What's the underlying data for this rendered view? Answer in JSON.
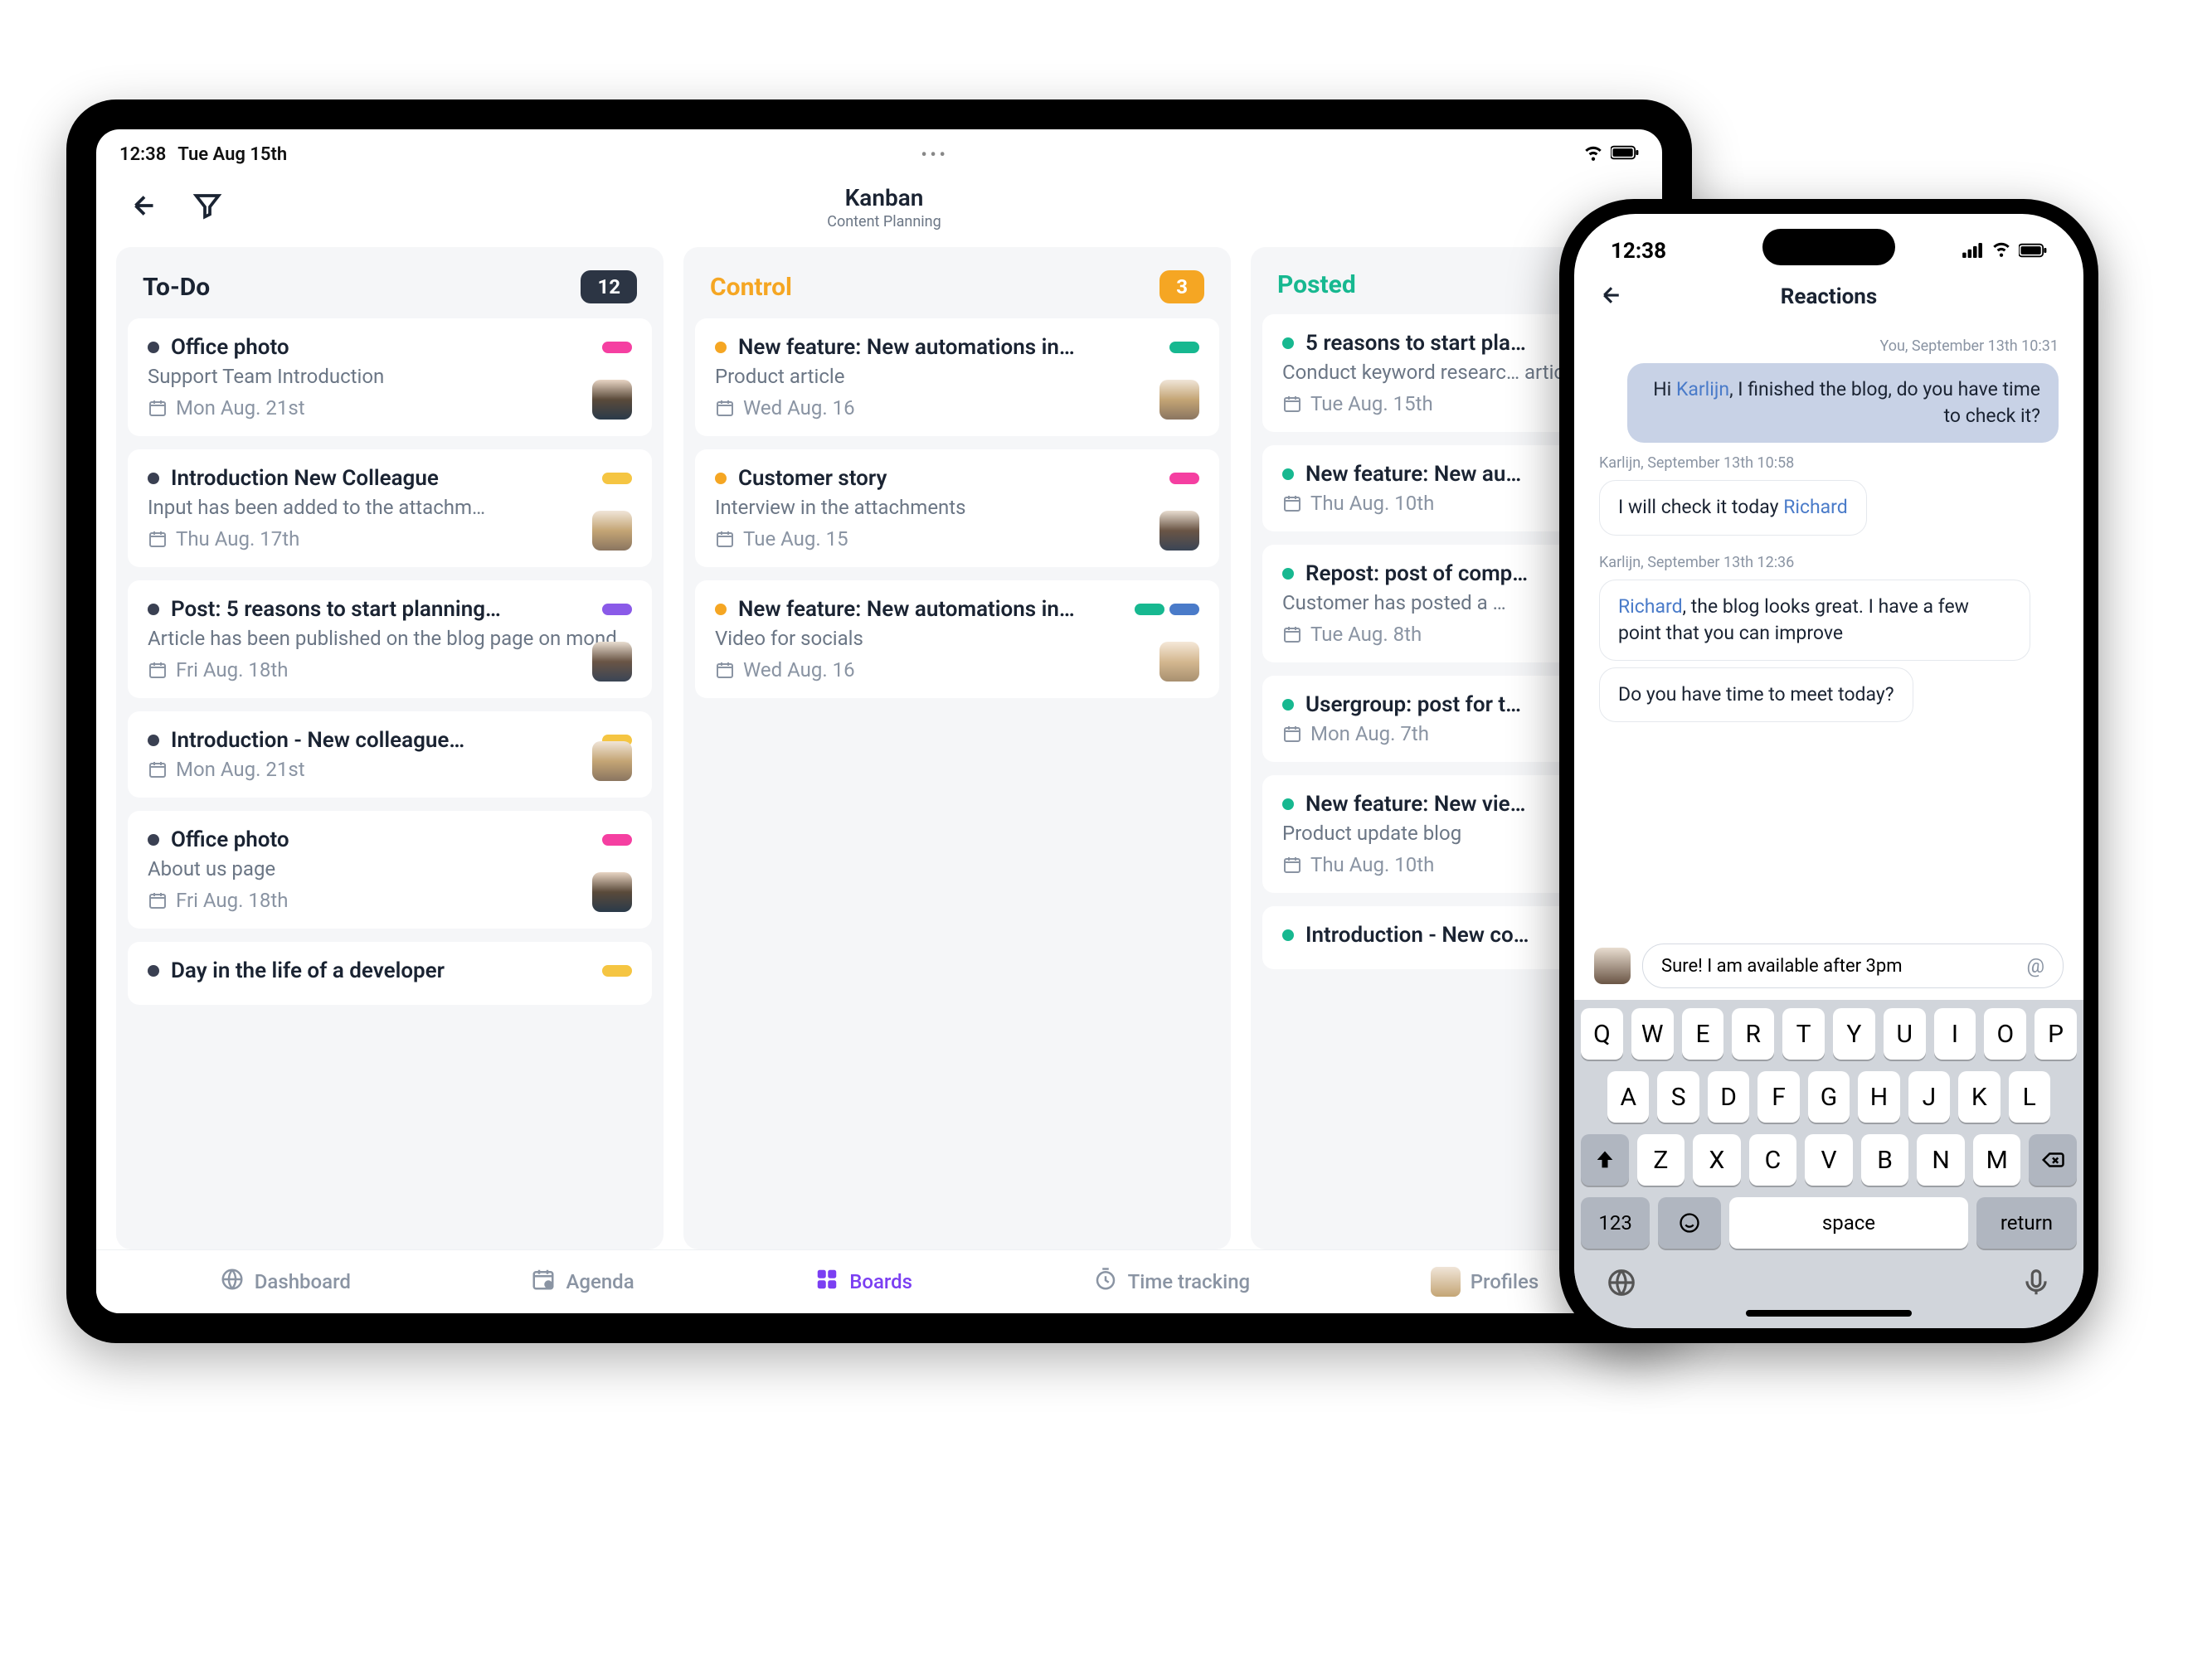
{
  "ipad": {
    "status": {
      "time": "12:38",
      "date": "Tue Aug 15th"
    },
    "header": {
      "title": "Kanban",
      "subtitle": "Content Planning"
    },
    "columns": [
      {
        "id": "todo",
        "title": "To-Do",
        "count": "12",
        "badgeClass": "badge-dark",
        "cards": [
          {
            "dot": "#3a4052",
            "title": "Office photo",
            "desc": "Support Team Introduction",
            "date": "Mon Aug. 21st",
            "pills": [
              "#f53fa1"
            ],
            "avatar": "a1"
          },
          {
            "dot": "#3a4052",
            "title": "Introduction New Colleague",
            "desc": "Input has been added to the attachm…",
            "date": "Thu Aug. 17th",
            "pills": [
              "#f5c542"
            ],
            "avatar": "a2"
          },
          {
            "dot": "#3a4052",
            "title": "Post: 5 reasons to start planning…",
            "desc": "Article has been published on the blog page on monday",
            "date": "Fri Aug. 18th",
            "pills": [
              "#8a5ae8"
            ],
            "avatar": "a3"
          },
          {
            "dot": "#3a4052",
            "title": "Introduction - New colleague…",
            "desc": "",
            "date": "Mon Aug. 21st",
            "pills": [
              "#f5c542"
            ],
            "avatar": "a2"
          },
          {
            "dot": "#3a4052",
            "title": "Office photo",
            "desc": "About us page",
            "date": "Fri Aug. 18th",
            "pills": [
              "#f53fa1"
            ],
            "avatar": "a1"
          },
          {
            "dot": "#3a4052",
            "title": "Day in the life of a developer",
            "desc": "",
            "date": "",
            "pills": [
              "#f5c542"
            ],
            "avatar": ""
          }
        ]
      },
      {
        "id": "control",
        "title": "Control",
        "count": "3",
        "badgeClass": "badge-orange",
        "cards": [
          {
            "dot": "#f5a623",
            "title": "New feature: New automations in…",
            "desc": "Product article",
            "date": "Wed Aug. 16",
            "pills": [
              "#17b890"
            ],
            "avatar": "a2"
          },
          {
            "dot": "#f5a623",
            "title": "Customer story",
            "desc": "Interview in the attachments",
            "date": "Tue Aug. 15",
            "pills": [
              "#f53fa1"
            ],
            "avatar": "a3"
          },
          {
            "dot": "#f5a623",
            "title": "New feature: New automations in…",
            "desc": "Video for socials",
            "date": "Wed Aug. 16",
            "pills": [
              "#17b890",
              "#4a7bc9"
            ],
            "avatar": "a4"
          }
        ]
      },
      {
        "id": "posted",
        "title": "Posted",
        "count": "",
        "badgeClass": "",
        "cards": [
          {
            "dot": "#17b890",
            "title": "5 reasons to start pla…",
            "desc": "Conduct keyword researc… article",
            "date": "Tue Aug. 15th",
            "pills": [],
            "avatar": ""
          },
          {
            "dot": "#17b890",
            "title": "New feature: New au…",
            "desc": "",
            "date": "Thu Aug. 10th",
            "pills": [],
            "avatar": ""
          },
          {
            "dot": "#17b890",
            "title": "Repost: post of comp…",
            "desc": "Customer has posted a …",
            "date": "Tue Aug. 8th",
            "pills": [],
            "avatar": ""
          },
          {
            "dot": "#17b890",
            "title": "Usergroup: post for t…",
            "desc": "",
            "date": "Mon Aug. 7th",
            "pills": [],
            "avatar": ""
          },
          {
            "dot": "#17b890",
            "title": "New feature: New vie…",
            "desc": "Product update blog",
            "date": "Thu Aug. 10th",
            "pills": [],
            "avatar": ""
          },
          {
            "dot": "#17b890",
            "title": "Introduction - New co…",
            "desc": "",
            "date": "",
            "pills": [],
            "avatar": ""
          }
        ]
      }
    ],
    "nav": [
      {
        "label": "Dashboard",
        "icon": "globe"
      },
      {
        "label": "Agenda",
        "icon": "calendar"
      },
      {
        "label": "Boards",
        "icon": "grid",
        "active": true
      },
      {
        "label": "Time tracking",
        "icon": "timer"
      },
      {
        "label": "Profiles",
        "icon": "avatar"
      }
    ]
  },
  "iphone": {
    "status": {
      "time": "12:38"
    },
    "header": {
      "title": "Reactions"
    },
    "messages": [
      {
        "meta": "You, September 13th 10:31",
        "metaSide": "right",
        "text_pre": "Hi ",
        "mention": "Karlijn",
        "text_post": ", I finished the blog, do you have time to check it?",
        "side": "sent"
      },
      {
        "meta": "Karlijn, September 13th 10:58",
        "metaSide": "left",
        "text_pre": "I will check it today ",
        "mention": "Richard",
        "text_post": "",
        "side": "recv"
      },
      {
        "meta": "Karlijn, September 13th 12:36",
        "metaSide": "left",
        "text_pre": "",
        "mention": "Richard",
        "text_post": ", the blog looks great. I have a few point that you can improve",
        "side": "recv"
      },
      {
        "meta": "",
        "metaSide": "",
        "text_pre": "Do you have time to meet today?",
        "mention": "",
        "text_post": "",
        "side": "recv"
      }
    ],
    "compose": {
      "value": "Sure! I am available after 3pm",
      "at": "@"
    },
    "keyboard": {
      "row1": [
        "Q",
        "W",
        "E",
        "R",
        "T",
        "Y",
        "U",
        "I",
        "O",
        "P"
      ],
      "row2": [
        "A",
        "S",
        "D",
        "F",
        "G",
        "H",
        "J",
        "K",
        "L"
      ],
      "row3": [
        "Z",
        "X",
        "C",
        "V",
        "B",
        "N",
        "M"
      ],
      "numKey": "123",
      "space": "space",
      "return": "return"
    }
  }
}
